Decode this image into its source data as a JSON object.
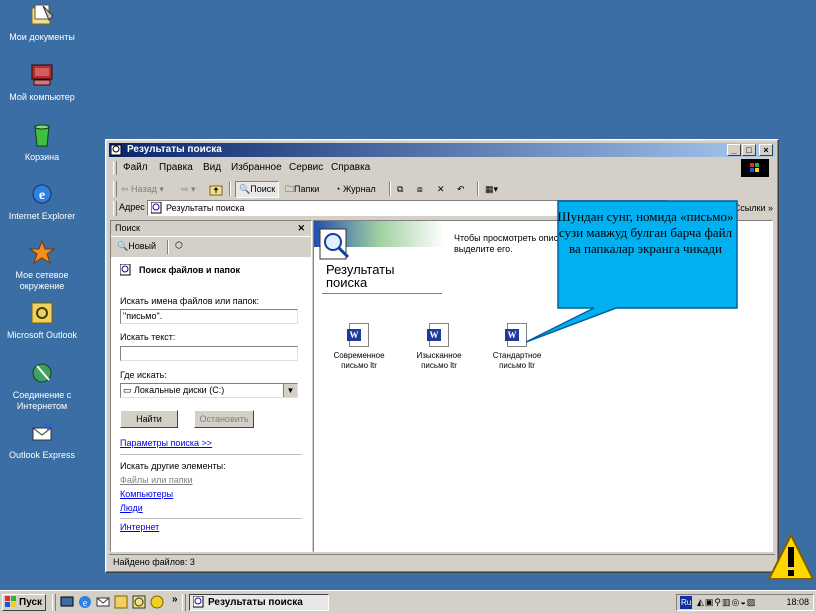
{
  "desktop": {
    "icons": [
      {
        "label": "Мои документы",
        "icon": "my-documents-icon"
      },
      {
        "label": "Мой компьютер",
        "icon": "my-computer-icon"
      },
      {
        "label": "Корзина",
        "icon": "recycle-bin-icon"
      },
      {
        "label": "Internet Explorer",
        "icon": "internet-explorer-icon"
      },
      {
        "label": "Мое сетевое окружение",
        "icon": "network-places-icon"
      },
      {
        "label": "Microsoft Outlook",
        "icon": "outlook-icon"
      },
      {
        "label": "Соединение с Интернетом",
        "icon": "internet-connection-icon"
      },
      {
        "label": "Outlook Express",
        "icon": "outlook-express-icon"
      }
    ]
  },
  "window": {
    "title": "Результаты поиска",
    "menu": [
      "Файл",
      "Правка",
      "Вид",
      "Избранное",
      "Сервис",
      "Справка"
    ],
    "toolbar": {
      "back": "Назад",
      "search": "Поиск",
      "folders": "Папки",
      "history": "Журнал"
    },
    "address": {
      "label": "Адрес",
      "value": "Результаты поиска",
      "links": "Ссылки"
    },
    "search_pane": {
      "header": "Поиск",
      "new_label": "Новый",
      "heading": "Поиск файлов и папок",
      "names_label": "Искать имена файлов или папок:",
      "names_value": "\"письмо\".",
      "text_label": "Искать текст:",
      "text_value": "",
      "where_label": "Где искать:",
      "where_value": "Локальные диски (C:)",
      "find_button": "Найти",
      "stop_button": "Остановить",
      "params_link": "Параметры поиска >>",
      "other_label": "Искать другие элементы:",
      "other_links": [
        "Файлы или папки",
        "Компьютеры",
        "Люди",
        "Интернет"
      ]
    },
    "results": {
      "header_title": "Результаты поиска",
      "hint": "Чтобы просмотреть опис выделите его.",
      "files": [
        {
          "name": "Современное письмо ltr"
        },
        {
          "name": "Изысканное письмо ltr"
        },
        {
          "name": "Стандартное письмо ltr"
        }
      ]
    },
    "status": "Найдено файлов: 3"
  },
  "callout": {
    "text": "Шундан сунг, номида «письмо» сузи мавжуд булган барча файл ва папкалар экранга чикади"
  },
  "taskbar": {
    "start": "Пуск",
    "task": "Результаты поиска",
    "lang": "Ru",
    "clock": "18:08"
  },
  "colors": {
    "desktop": "#3a6ea5",
    "titlebar_start": "#0a246a",
    "callout_fill": "#00b0f0",
    "warning_fill": "#ffd700"
  }
}
